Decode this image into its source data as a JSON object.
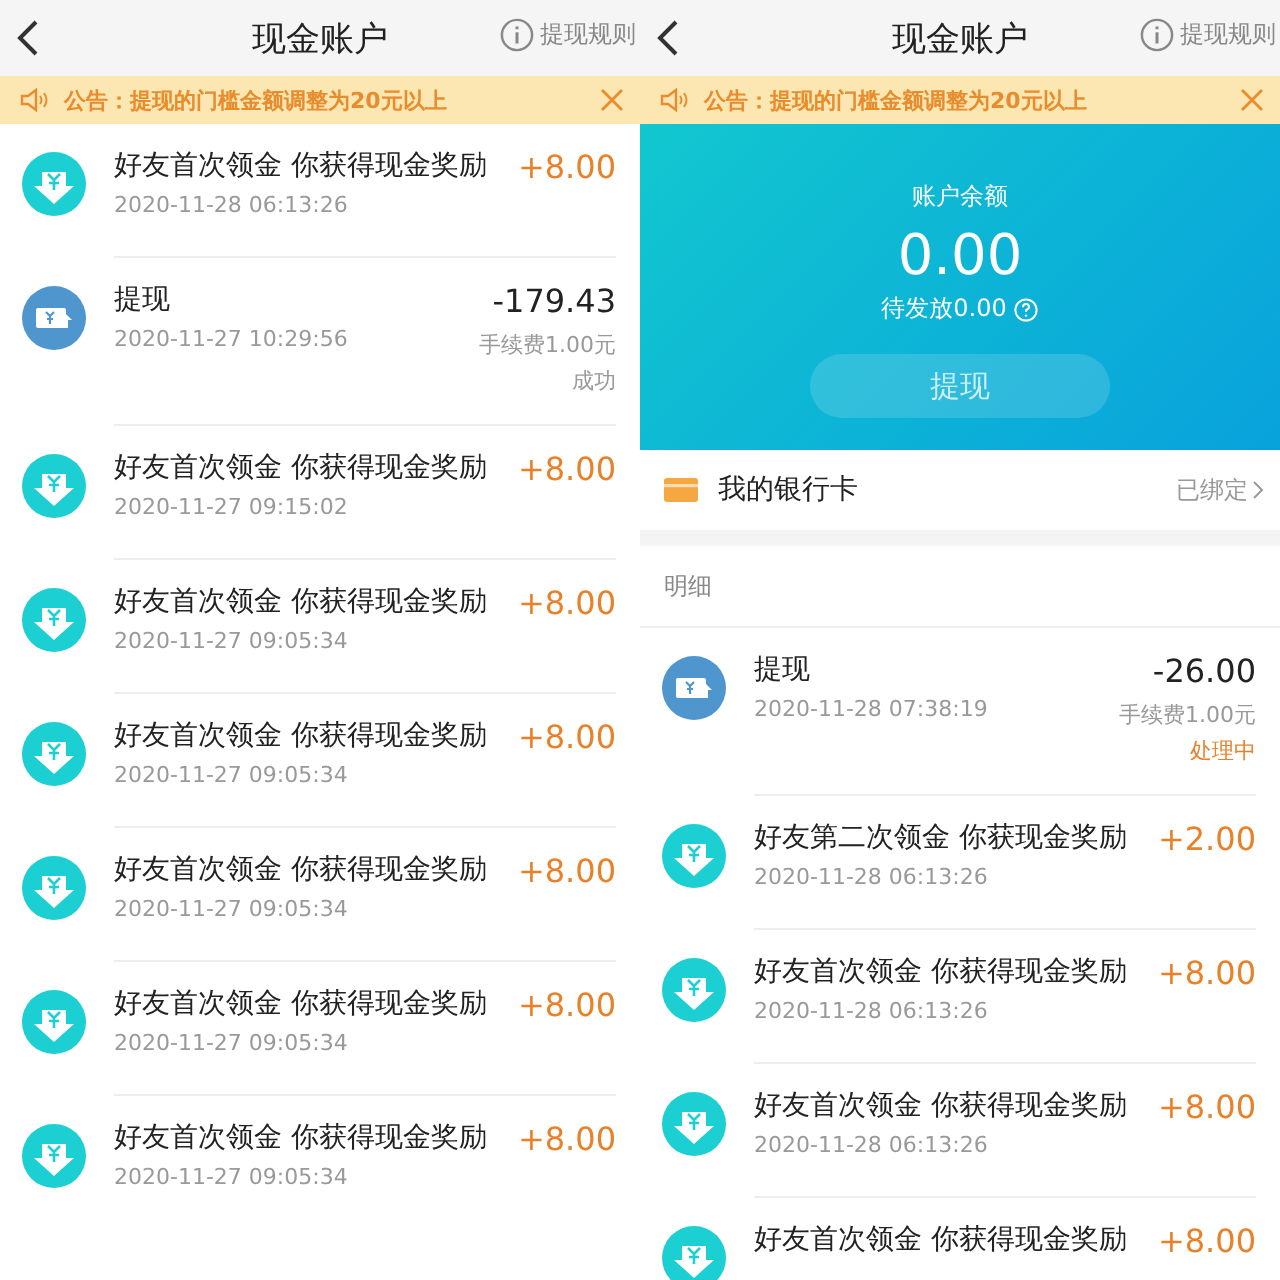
{
  "panels": [
    {
      "header": {
        "title": "现金账户",
        "rules": "提现规则"
      },
      "notice": {
        "text": "公告：提现的门槛金额调整为20元以上"
      },
      "records": [
        {
          "kind": "reward",
          "title": "好友首次领金 你获得现金奖励",
          "time": "2020-11-28 06:13:26",
          "amount": "+8.00"
        },
        {
          "kind": "withdraw",
          "title": "提现",
          "time": "2020-11-27 10:29:56",
          "amount": "-179.43",
          "fee": "手续费1.00元",
          "status": "成功",
          "pending": false
        },
        {
          "kind": "reward",
          "title": "好友首次领金 你获得现金奖励",
          "time": "2020-11-27 09:15:02",
          "amount": "+8.00"
        },
        {
          "kind": "reward",
          "title": "好友首次领金 你获得现金奖励",
          "time": "2020-11-27 09:05:34",
          "amount": "+8.00"
        },
        {
          "kind": "reward",
          "title": "好友首次领金 你获得现金奖励",
          "time": "2020-11-27 09:05:34",
          "amount": "+8.00"
        },
        {
          "kind": "reward",
          "title": "好友首次领金 你获得现金奖励",
          "time": "2020-11-27 09:05:34",
          "amount": "+8.00"
        },
        {
          "kind": "reward",
          "title": "好友首次领金 你获得现金奖励",
          "time": "2020-11-27 09:05:34",
          "amount": "+8.00"
        },
        {
          "kind": "reward",
          "title": "好友首次领金 你获得现金奖励",
          "time": "2020-11-27 09:05:34",
          "amount": "+8.00"
        }
      ]
    },
    {
      "header": {
        "title": "现金账户",
        "rules": "提现规则"
      },
      "notice": {
        "text": "公告：提现的门槛金额调整为20元以上"
      },
      "balance": {
        "label": "账户余额",
        "amount": "0.00",
        "pending": "待发放0.00",
        "button": "提现"
      },
      "bank_card": {
        "label": "我的银行卡",
        "status": "已绑定"
      },
      "details_title": "明细",
      "records": [
        {
          "kind": "withdraw",
          "title": "提现",
          "time": "2020-11-28 07:38:19",
          "amount": "-26.00",
          "fee": "手续费1.00元",
          "status": "处理中",
          "pending": true
        },
        {
          "kind": "reward",
          "title": "好友第二次领金 你获现金奖励",
          "time": "2020-11-28 06:13:26",
          "amount": "+2.00"
        },
        {
          "kind": "reward",
          "title": "好友首次领金 你获得现金奖励",
          "time": "2020-11-28 06:13:26",
          "amount": "+8.00"
        },
        {
          "kind": "reward",
          "title": "好友首次领金 你获得现金奖励",
          "time": "2020-11-28 06:13:26",
          "amount": "+8.00"
        },
        {
          "kind": "reward",
          "title": "好友首次领金 你获得现金奖励",
          "amount": "+8.00"
        }
      ]
    }
  ]
}
